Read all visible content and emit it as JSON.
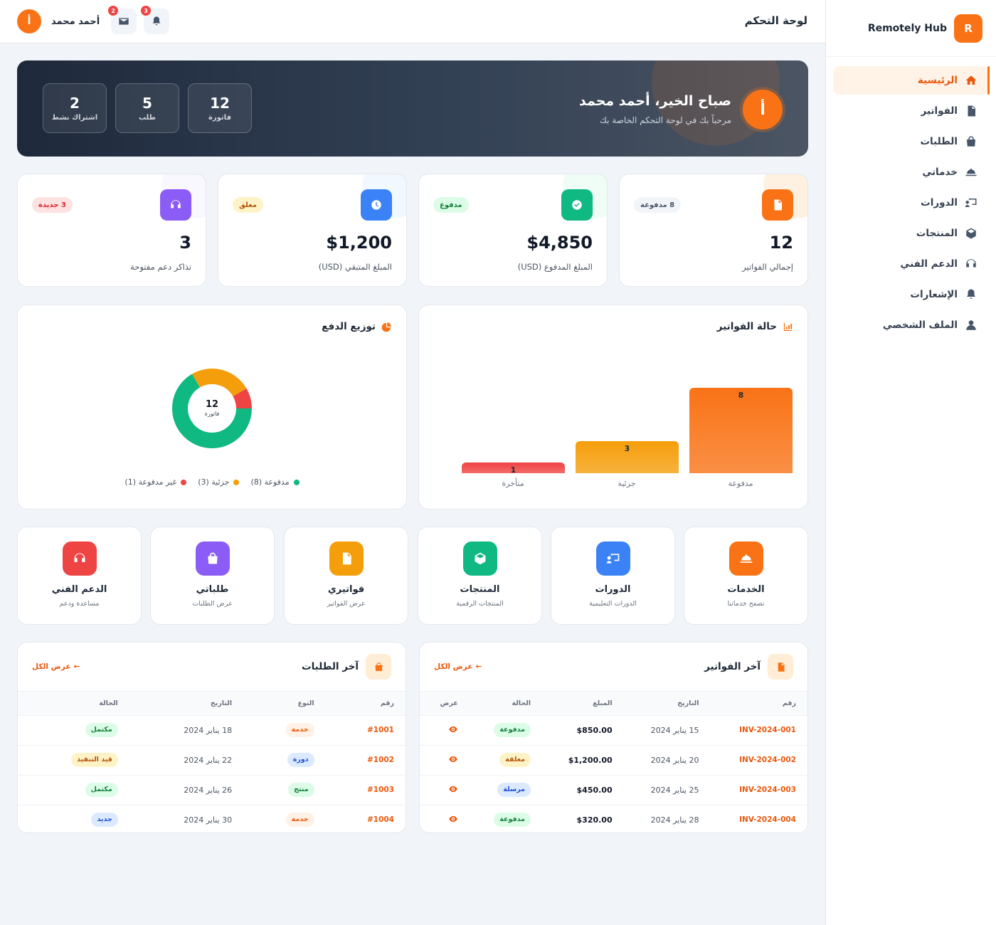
{
  "sidebar": {
    "brand_logo": "R",
    "brand_name": "Remotely Hub",
    "items": [
      {
        "label": "الرئيسية",
        "icon": "home-icon"
      },
      {
        "label": "الفواتير",
        "icon": "invoice-icon"
      },
      {
        "label": "الطلبات",
        "icon": "bag-icon"
      },
      {
        "label": "خدماتي",
        "icon": "service-bell-icon"
      },
      {
        "label": "الدورات",
        "icon": "teacher-icon"
      },
      {
        "label": "المنتجات",
        "icon": "box-icon"
      },
      {
        "label": "الدعم الفني",
        "icon": "headset-icon"
      },
      {
        "label": "الإشعارات",
        "icon": "bell-icon"
      },
      {
        "label": "الملف الشخصي",
        "icon": "user-icon"
      }
    ]
  },
  "topbar": {
    "title": "لوحة التحكم",
    "user_name": "أحمد محمد",
    "avatar_letter": "أ",
    "notifications_count": "3",
    "messages_count": "2"
  },
  "welcome": {
    "avatar_letter": "أ",
    "title": "صباح الخير، أحمد محمد",
    "subtitle": "مرحباً بك في لوحة التحكم الخاصة بك",
    "stats": [
      {
        "value": "12",
        "label": "فاتورة"
      },
      {
        "value": "5",
        "label": "طلب"
      },
      {
        "value": "2",
        "label": "اشتراك نشط"
      }
    ]
  },
  "stats": [
    {
      "value": "12",
      "label": "إجمالي الفواتير",
      "badge": "8 مدفوعة",
      "color": "#f97316"
    },
    {
      "value": "$4,850",
      "label": "المبلغ المدفوع (USD)",
      "badge": "مدفوع",
      "color": "#10b981"
    },
    {
      "value": "$1,200",
      "label": "المبلغ المتبقي (USD)",
      "badge": "معلق",
      "color": "#3b82f6"
    },
    {
      "value": "3",
      "label": "تذاكر دعم مفتوحة",
      "badge": "3 جديدة",
      "color": "#8b5cf6"
    }
  ],
  "invoice_status": {
    "title": "حالة الفواتير",
    "chart_data": {
      "type": "bar",
      "categories": [
        "مدفوعة",
        "جزئية",
        "متأخرة"
      ],
      "values": [
        8,
        3,
        1
      ],
      "colors": [
        "#f97316",
        "#f59e0b",
        "#ef4444"
      ]
    }
  },
  "payment_distribution": {
    "title": "توزيع الدفع",
    "center_value": "12",
    "center_label": "فاتورة",
    "chart_data": {
      "type": "pie",
      "labels": [
        "مدفوعة",
        "جزئية",
        "غير مدفوعة"
      ],
      "values": [
        8,
        3,
        1
      ],
      "colors": [
        "#10b981",
        "#f59e0b",
        "#ef4444"
      ]
    },
    "legend": [
      "مدفوعة (8)",
      "جزئية (3)",
      "غير مدفوعة (1)"
    ]
  },
  "quick_links": [
    {
      "title": "الخدمات",
      "subtitle": "تصفح خدماتنا",
      "icon": "service-bell-icon",
      "color": "#f97316"
    },
    {
      "title": "الدورات",
      "subtitle": "الدورات التعليمية",
      "icon": "teacher-icon",
      "color": "#3b82f6"
    },
    {
      "title": "المنتجات",
      "subtitle": "المنتجات الرقمية",
      "icon": "box-icon",
      "color": "#10b981"
    },
    {
      "title": "فواتيري",
      "subtitle": "عرض الفواتير",
      "icon": "invoice-icon",
      "color": "#f59e0b"
    },
    {
      "title": "طلباتي",
      "subtitle": "عرض الطلبات",
      "icon": "bag-icon",
      "color": "#8b5cf6"
    },
    {
      "title": "الدعم الفني",
      "subtitle": "مساعدة ودعم",
      "icon": "headset-icon",
      "color": "#ef4444"
    }
  ],
  "latest_invoices": {
    "title": "آخر الفواتير",
    "view_all": "عرض الكل",
    "columns": [
      "رقم",
      "التاريخ",
      "المبلغ",
      "الحالة",
      "عرض"
    ],
    "rows": [
      {
        "id": "INV-2024-001",
        "date": "15 يناير 2024",
        "amount": "$850.00",
        "status": "مدفوعة",
        "status_type": "green"
      },
      {
        "id": "INV-2024-002",
        "date": "20 يناير 2024",
        "amount": "$1,200.00",
        "status": "معلقة",
        "status_type": "yellow"
      },
      {
        "id": "INV-2024-003",
        "date": "25 يناير 2024",
        "amount": "$450.00",
        "status": "مرسلة",
        "status_type": "blue"
      },
      {
        "id": "INV-2024-004",
        "date": "28 يناير 2024",
        "amount": "$320.00",
        "status": "مدفوعة",
        "status_type": "green"
      }
    ]
  },
  "latest_orders": {
    "title": "آخر الطلبات",
    "view_all": "عرض الكل",
    "columns": [
      "رقم",
      "النوع",
      "التاريخ",
      "الحالة"
    ],
    "rows": [
      {
        "id": "#1001",
        "type": "خدمة",
        "type_style": "orange",
        "date": "18 يناير 2024",
        "status": "مكتمل",
        "status_type": "green"
      },
      {
        "id": "#1002",
        "type": "دورة",
        "type_style": "blue",
        "date": "22 يناير 2024",
        "status": "قيد التنفيذ",
        "status_type": "yellow"
      },
      {
        "id": "#1003",
        "type": "منتج",
        "type_style": "green",
        "date": "26 يناير 2024",
        "status": "مكتمل",
        "status_type": "green"
      },
      {
        "id": "#1004",
        "type": "خدمة",
        "type_style": "orange",
        "date": "30 يناير 2024",
        "status": "جديد",
        "status_type": "blue"
      }
    ]
  }
}
